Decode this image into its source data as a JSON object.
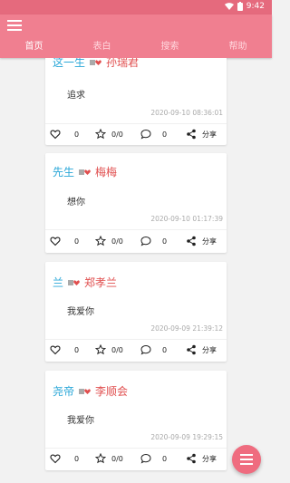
{
  "status_bar": {
    "time": "9:42"
  },
  "tabs": [
    {
      "label": "首页",
      "active": true
    },
    {
      "label": "表白",
      "active": false
    },
    {
      "label": "搜索",
      "active": false
    },
    {
      "label": "帮助",
      "active": false
    }
  ],
  "posts": [
    {
      "from": "这一生",
      "to": "孙瑞君",
      "message": "追求",
      "timestamp": "2020-09-10 08:36:01",
      "likes": "0",
      "reposts": "0/0",
      "comments": "0",
      "share_label": "分享"
    },
    {
      "from": "先生",
      "to": "梅梅",
      "message": "想你",
      "timestamp": "2020-09-10 01:17:39",
      "likes": "0",
      "reposts": "0/0",
      "comments": "0",
      "share_label": "分享"
    },
    {
      "from": "兰",
      "to": "郑孝兰",
      "message": "我爱你",
      "timestamp": "2020-09-09 21:39:12",
      "likes": "0",
      "reposts": "0/0",
      "comments": "0",
      "share_label": "分享"
    },
    {
      "from": "尧帝",
      "to": "李顺会",
      "message": "我爱你",
      "timestamp": "2020-09-09 19:29:15",
      "likes": "0",
      "reposts": "0/0",
      "comments": "0",
      "share_label": "分享"
    }
  ],
  "colors": {
    "appbar": "#f07f90",
    "statusbar": "#e56a7d",
    "sender": "#2aa7d8",
    "receiver": "#e04e4e",
    "fab": "#ef6c7f"
  },
  "icons": {
    "menu": "hamburger-icon",
    "like": "heart-outline-icon",
    "repost": "star-repost-icon",
    "comment": "comment-bubble-icon",
    "share": "share-icon",
    "fab": "menu-fab-icon"
  }
}
